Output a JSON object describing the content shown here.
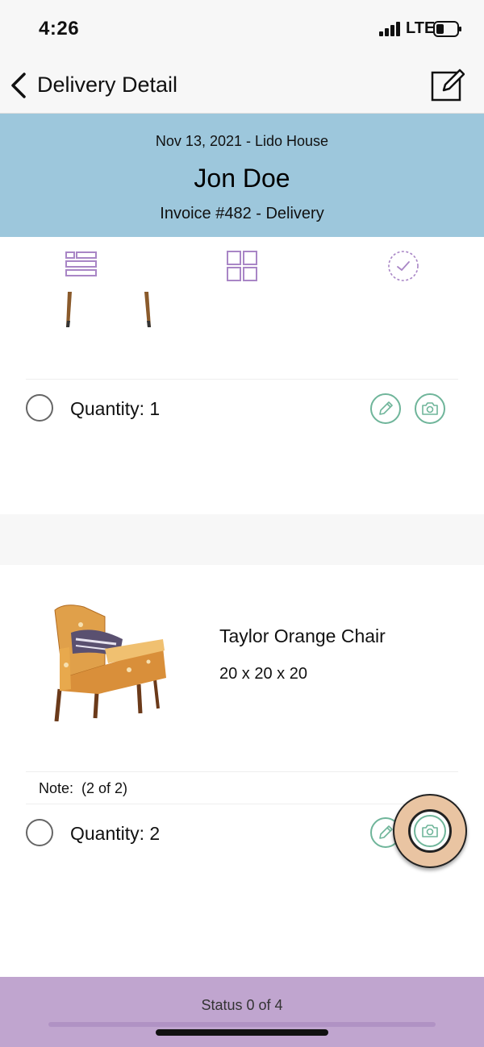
{
  "status_bar": {
    "time": "4:26",
    "network": "LTE"
  },
  "nav": {
    "title": "Delivery Detail",
    "back_icon": "chevron-left-icon",
    "edit_icon": "edit-icon"
  },
  "header": {
    "date_location": "Nov 13, 2021 - Lido House",
    "customer_name": "Jon Doe",
    "invoice": "Invoice #482 - Delivery",
    "background_color": "#9dc7dc"
  },
  "view_tabs": [
    {
      "name": "list-view",
      "icon": "list-icon"
    },
    {
      "name": "grid-view",
      "icon": "grid-icon"
    },
    {
      "name": "completed-view",
      "icon": "check-circle-icon"
    }
  ],
  "items": [
    {
      "quantity_label": "Quantity: 1"
    },
    {
      "name": "Taylor Orange Chair",
      "dimensions": "20 x 20 x 20",
      "note": "Note:  (2 of 2)",
      "quantity_label": "Quantity: 2"
    }
  ],
  "footer": {
    "status": "Status 0 of 4",
    "background_color": "#c0a5cf"
  },
  "colors": {
    "accent_green": "#6fb59a",
    "tab_purple": "#a986c6"
  }
}
